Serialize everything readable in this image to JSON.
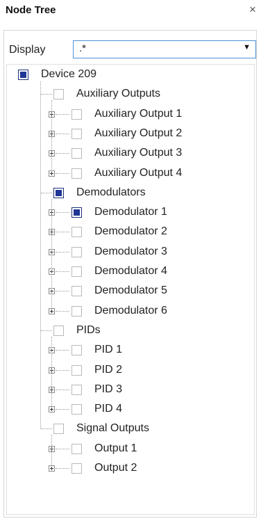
{
  "header": {
    "title": "Node Tree",
    "close_glyph": "×"
  },
  "display": {
    "label": "Display",
    "value": ".*",
    "arrow_glyph": "▼"
  },
  "tree": {
    "root": {
      "label": "Device 209",
      "checked": true
    },
    "groups": [
      {
        "label": "Auxiliary Outputs",
        "checked": false,
        "children": [
          {
            "label": "Auxiliary Output 1",
            "checked": false
          },
          {
            "label": "Auxiliary Output 2",
            "checked": false
          },
          {
            "label": "Auxiliary Output 3",
            "checked": false
          },
          {
            "label": "Auxiliary Output 4",
            "checked": false
          }
        ]
      },
      {
        "label": "Demodulators",
        "checked": true,
        "children": [
          {
            "label": "Demodulator 1",
            "checked": true
          },
          {
            "label": "Demodulator 2",
            "checked": false
          },
          {
            "label": "Demodulator 3",
            "checked": false
          },
          {
            "label": "Demodulator 4",
            "checked": false
          },
          {
            "label": "Demodulator 5",
            "checked": false
          },
          {
            "label": "Demodulator 6",
            "checked": false
          }
        ]
      },
      {
        "label": "PIDs",
        "checked": false,
        "children": [
          {
            "label": "PID 1",
            "checked": false
          },
          {
            "label": "PID 2",
            "checked": false
          },
          {
            "label": "PID 3",
            "checked": false
          },
          {
            "label": "PID 4",
            "checked": false
          }
        ]
      },
      {
        "label": "Signal Outputs",
        "checked": false,
        "children": [
          {
            "label": "Output 1",
            "checked": false
          },
          {
            "label": "Output 2",
            "checked": false
          }
        ]
      }
    ]
  }
}
